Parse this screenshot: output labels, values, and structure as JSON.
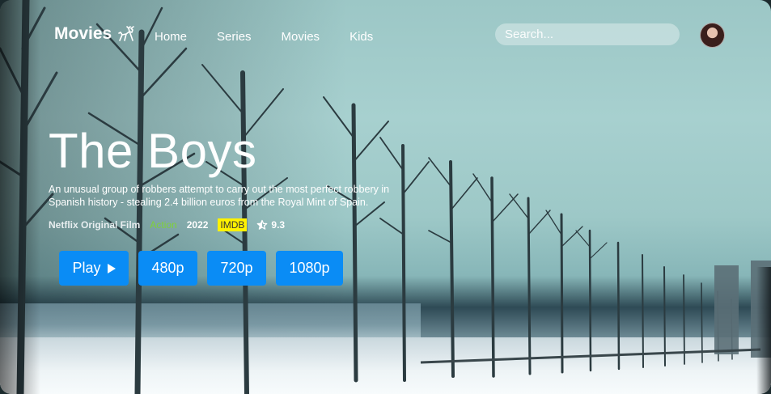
{
  "nav": {
    "logo_text": "Movies",
    "logo_icon": "reindeer-icon",
    "items": [
      {
        "label": "Home"
      },
      {
        "label": "Series"
      },
      {
        "label": "Movies"
      },
      {
        "label": "Kids"
      }
    ],
    "search_placeholder": "Search...",
    "avatar": "user-avatar"
  },
  "hero": {
    "title": "The Boys",
    "description": "An unusual group of robbers attempt to carry out the most perfect robbery in Spanish history - stealing 2.4 billion euros from the Royal Mint of Spain.",
    "studio": "Netflix Original Film",
    "genre": "Action",
    "year": "2022",
    "imdb_label": "IMDB",
    "rating": "9.3",
    "rating_icon": "star-icon"
  },
  "actions": {
    "play_label": "Play",
    "play_icon": "play-icon",
    "res_480": "480p",
    "res_720": "720p",
    "res_1080": "1080p"
  },
  "colors": {
    "accent": "#0a8cf5",
    "genre": "#7fd13a",
    "imdb_badge": "#fff200"
  }
}
